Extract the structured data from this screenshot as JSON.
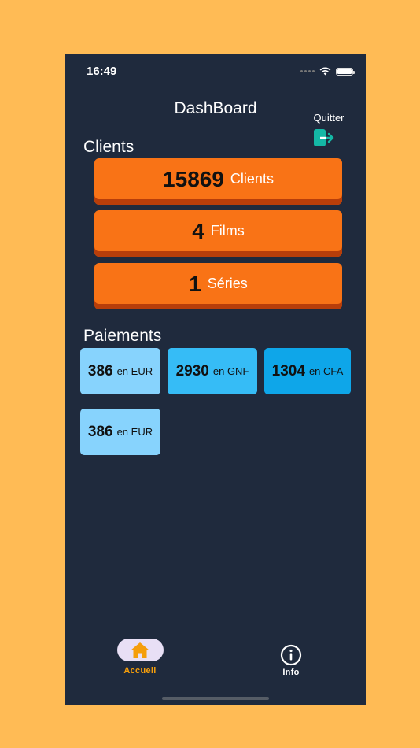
{
  "status": {
    "time": "16:49"
  },
  "header": {
    "title": "DashBoard",
    "quit_label": "Quitter"
  },
  "clients_section": {
    "title": "Clients",
    "cards": [
      {
        "value": "15869",
        "unit": "Clients"
      },
      {
        "value": "4",
        "unit": "Films"
      },
      {
        "value": "1",
        "unit": "Séries"
      }
    ]
  },
  "payments_section": {
    "title": "Paiements",
    "cards": [
      {
        "value": "386",
        "unit": "en EUR",
        "color": "#87D3FD"
      },
      {
        "value": "2930",
        "unit": "en GNF",
        "color": "#36BCF6"
      },
      {
        "value": "1304",
        "unit": "en CFA",
        "color": "#0EA6E9"
      },
      {
        "value": "386",
        "unit": "en EUR",
        "color": "#87D3FD"
      }
    ]
  },
  "tabbar": {
    "home_label": "Accueil",
    "info_label": "Info",
    "home_color": "#F59E0B",
    "info_color": "#FFFFFF"
  },
  "colors": {
    "background": "#FFBB55",
    "screen": "#1F2A3D",
    "card_orange": "#F97316",
    "quit_icon": "#14B8A6"
  }
}
